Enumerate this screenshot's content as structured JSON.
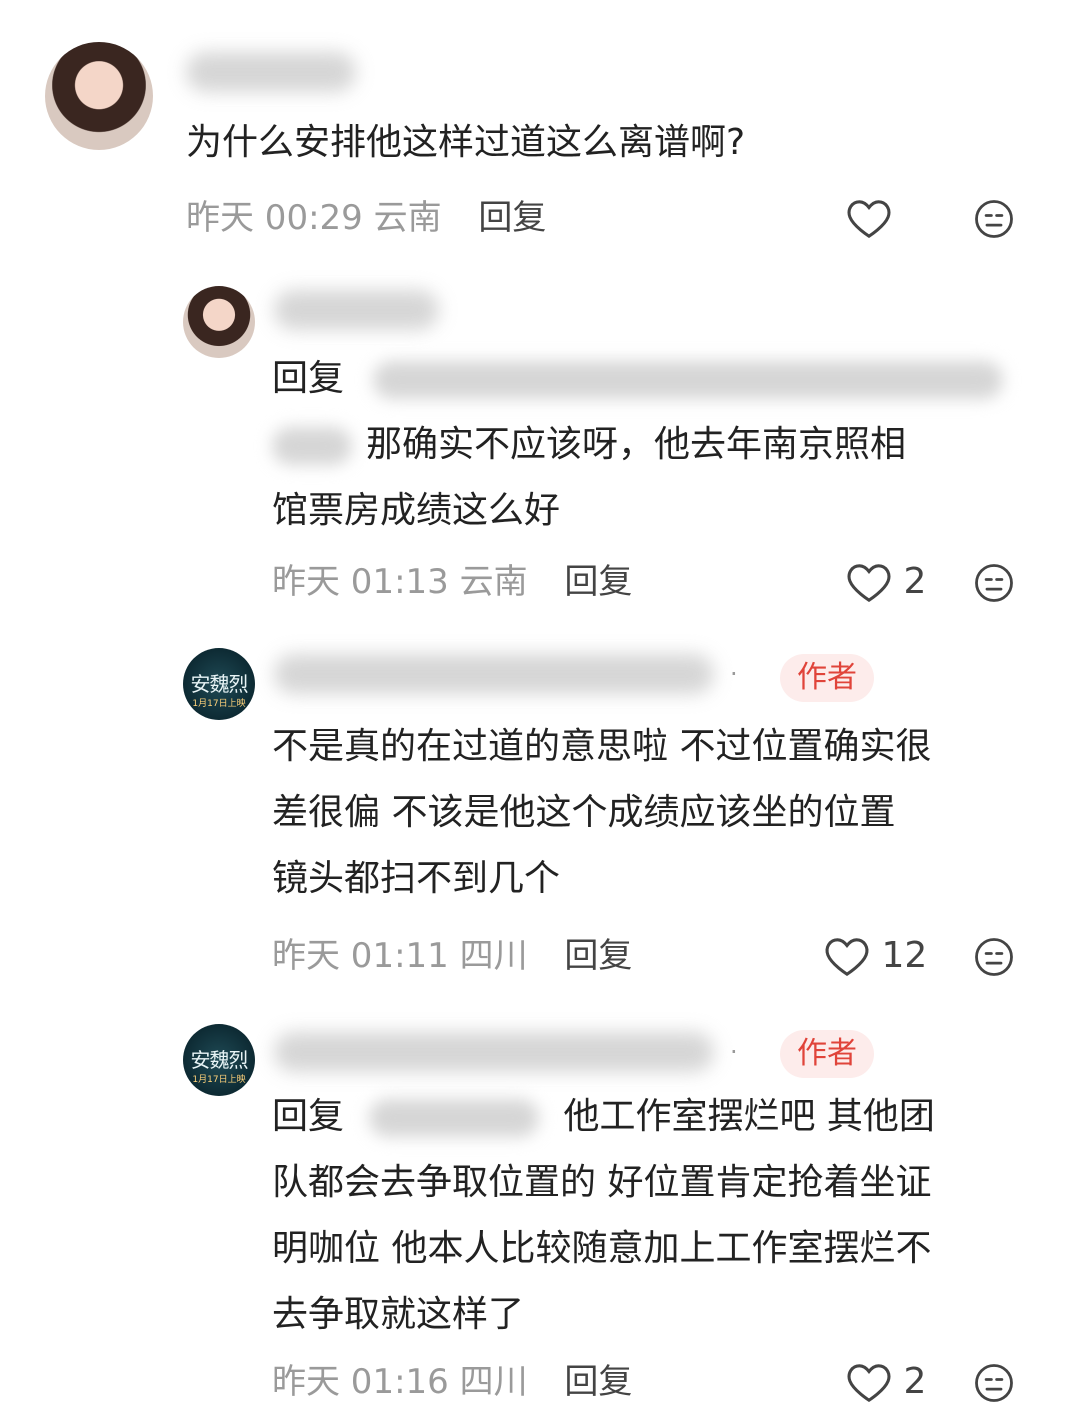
{
  "comments": [
    {
      "text": "为什么安排他这样过道这么离谱啊?",
      "time": "昨天 00:29",
      "location": "云南",
      "reply_label": "回复",
      "likes": ""
    },
    {
      "reply_prefix": "回复",
      "text_line1": "那确实不应该呀，他去年南京照相",
      "text_line2": "馆票房成绩这么好",
      "time": "昨天 01:13",
      "location": "云南",
      "reply_label": "回复",
      "likes": "2"
    },
    {
      "badge": "作者",
      "sep": "·",
      "text_line1": "不是真的在过道的意思啦 不过位置确实很",
      "text_line2": "差很偏 不该是他这个成绩应该坐的位置",
      "text_line3": "镜头都扫不到几个",
      "time": "昨天 01:11",
      "location": "四川",
      "reply_label": "回复",
      "likes": "12",
      "avatar_line1": "安魏烈",
      "avatar_line2": "1月17日上映"
    },
    {
      "badge": "作者",
      "sep": "·",
      "reply_prefix": "回复",
      "text_line1": "他工作室摆烂吧 其他团",
      "text_line2": "队都会去争取位置的 好位置肯定抢着坐证",
      "text_line3": "明咖位 他本人比较随意加上工作室摆烂不",
      "text_line4": "去争取就这样了",
      "time": "昨天 01:16",
      "location": "四川",
      "reply_label": "回复",
      "likes": "2",
      "avatar_line1": "安魏烈",
      "avatar_line2": "1月17日上映"
    }
  ],
  "icons": {
    "like": "heart-outline-icon",
    "dislike": "meh-face-icon"
  },
  "colors": {
    "badge_text": "#e0443a",
    "badge_bg": "#fdeceb",
    "meta": "#9a9a9a"
  }
}
